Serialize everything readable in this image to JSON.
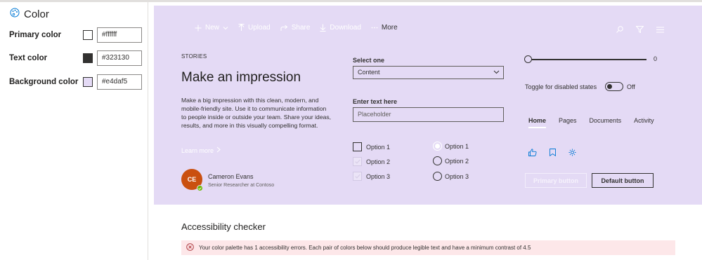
{
  "panel": {
    "title": "Color",
    "colors": [
      {
        "label": "Primary color",
        "value": "#ffffff",
        "swatch": "#ffffff"
      },
      {
        "label": "Text color",
        "value": "#323130",
        "swatch": "#323130"
      },
      {
        "label": "Background color",
        "value": "#e4daf5",
        "swatch": "#e4daf5"
      }
    ]
  },
  "preview": {
    "background": "#e4daf5",
    "commandbar": {
      "new": "New",
      "upload": "Upload",
      "share": "Share",
      "download": "Download",
      "more": "More"
    },
    "story": {
      "kicker": "STORIES",
      "headline": "Make an impression",
      "description": "Make a big impression with this clean, modern, and mobile-friendly site. Use it to communicate information to people inside or outside your team. Share your ideas, results, and more in this visually compelling format.",
      "learn_more": "Learn more"
    },
    "person": {
      "initials": "CE",
      "name": "Cameron Evans",
      "role": "Senior Researcher at Contoso"
    },
    "select": {
      "label": "Select one",
      "value": "Content"
    },
    "textfield": {
      "label": "Enter text here",
      "placeholder": "Placeholder"
    },
    "checkboxes": [
      "Option 1",
      "Option 2",
      "Option 3"
    ],
    "radios": [
      "Option 1",
      "Option 2",
      "Option 3"
    ],
    "slider": {
      "value": "0"
    },
    "toggle": {
      "label": "Toggle for disabled states",
      "state": "Off"
    },
    "pivots": [
      "Home",
      "Pages",
      "Documents",
      "Activity"
    ],
    "buttons": {
      "primary": "Primary button",
      "default": "Default button"
    }
  },
  "accessibility": {
    "title": "Accessibility checker",
    "error": "Your color palette has 1 accessibility errors. Each pair of colors below should produce legible text and have a minimum contrast of 4.5"
  }
}
